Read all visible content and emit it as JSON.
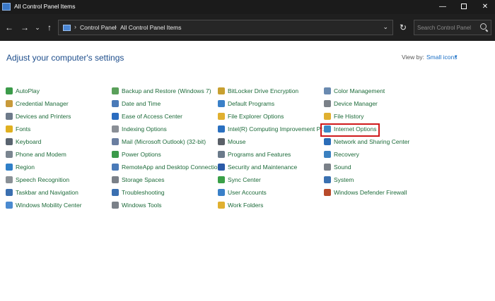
{
  "window": {
    "title": "All Control Panel Items",
    "controls": {
      "minimize": "—",
      "close": "✕"
    }
  },
  "navigation": {
    "back": "←",
    "forward": "→",
    "recent": "⌄",
    "up": "↑",
    "breadcrumb": [
      "Control Panel",
      "All Control Panel Items"
    ],
    "separator": "›",
    "dropdown": "⌄",
    "refresh": "↻",
    "search_placeholder": "Search Control Panel"
  },
  "header": {
    "title": "Adjust your computer's settings",
    "view_by_label": "View by:",
    "view_by_value": "Small icons",
    "view_by_caret": "▾"
  },
  "items": [
    {
      "label": "AutoPlay",
      "icon": "autoplay-icon",
      "color": "#3b9b4a"
    },
    {
      "label": "Credential Manager",
      "icon": "credential-manager-icon",
      "color": "#c89a3a"
    },
    {
      "label": "Devices and Printers",
      "icon": "devices-printers-icon",
      "color": "#6d7a8a"
    },
    {
      "label": "Fonts",
      "icon": "fonts-icon",
      "color": "#e0b020"
    },
    {
      "label": "Keyboard",
      "icon": "keyboard-icon",
      "color": "#5a6470"
    },
    {
      "label": "Phone and Modem",
      "icon": "phone-modem-icon",
      "color": "#7a8590"
    },
    {
      "label": "Region",
      "icon": "region-icon",
      "color": "#2f7fc8"
    },
    {
      "label": "Speech Recognition",
      "icon": "speech-recognition-icon",
      "color": "#8a9096"
    },
    {
      "label": "Taskbar and Navigation",
      "icon": "taskbar-icon",
      "color": "#3a6fb0"
    },
    {
      "label": "Windows Mobility Center",
      "icon": "mobility-center-icon",
      "color": "#4a8ad0"
    },
    {
      "label": "Backup and Restore (Windows 7)",
      "icon": "backup-restore-icon",
      "color": "#5aa05a"
    },
    {
      "label": "Date and Time",
      "icon": "date-time-icon",
      "color": "#4a7ab8"
    },
    {
      "label": "Ease of Access Center",
      "icon": "ease-of-access-icon",
      "color": "#2a6cc0"
    },
    {
      "label": "Indexing Options",
      "icon": "indexing-options-icon",
      "color": "#8a8f96"
    },
    {
      "label": "Mail (Microsoft Outlook) (32-bit)",
      "icon": "mail-icon",
      "color": "#6a7ea0"
    },
    {
      "label": "Power Options",
      "icon": "power-options-icon",
      "color": "#3a9a4a"
    },
    {
      "label": "RemoteApp and Desktop Connections",
      "icon": "remoteapp-icon",
      "color": "#4a7ab8"
    },
    {
      "label": "Storage Spaces",
      "icon": "storage-spaces-icon",
      "color": "#7a8088"
    },
    {
      "label": "Troubleshooting",
      "icon": "troubleshooting-icon",
      "color": "#3a6fb0"
    },
    {
      "label": "Windows Tools",
      "icon": "windows-tools-icon",
      "color": "#7a8088"
    },
    {
      "label": "BitLocker Drive Encryption",
      "icon": "bitlocker-icon",
      "color": "#c8a030"
    },
    {
      "label": "Default Programs",
      "icon": "default-programs-icon",
      "color": "#3a80c8"
    },
    {
      "label": "File Explorer Options",
      "icon": "file-explorer-options-icon",
      "color": "#e0b030"
    },
    {
      "label": "Intel(R) Computing Improvement Pr...",
      "icon": "intel-icon",
      "color": "#2a70c0"
    },
    {
      "label": "Mouse",
      "icon": "mouse-icon",
      "color": "#5a6068"
    },
    {
      "label": "Programs and Features",
      "icon": "programs-features-icon",
      "color": "#6a7a8a"
    },
    {
      "label": "Security and Maintenance",
      "icon": "security-maintenance-icon",
      "color": "#2a5aa8"
    },
    {
      "label": "Sync Center",
      "icon": "sync-center-icon",
      "color": "#3aa048"
    },
    {
      "label": "User Accounts",
      "icon": "user-accounts-icon",
      "color": "#3a80c8"
    },
    {
      "label": "Work Folders",
      "icon": "work-folders-icon",
      "color": "#e0b030"
    },
    {
      "label": "Color Management",
      "icon": "color-management-icon",
      "color": "#6a8ab0"
    },
    {
      "label": "Device Manager",
      "icon": "device-manager-icon",
      "color": "#7a8088"
    },
    {
      "label": "File History",
      "icon": "file-history-icon",
      "color": "#e0b030"
    },
    {
      "label": "Internet Options",
      "icon": "internet-options-icon",
      "color": "#3a8ac8"
    },
    {
      "label": "Network and Sharing Center",
      "icon": "network-sharing-icon",
      "color": "#2a6cb8"
    },
    {
      "label": "Recovery",
      "icon": "recovery-icon",
      "color": "#3a80c0"
    },
    {
      "label": "Sound",
      "icon": "sound-icon",
      "color": "#7a8088"
    },
    {
      "label": "System",
      "icon": "system-icon",
      "color": "#3a70b0"
    },
    {
      "label": "Windows Defender Firewall",
      "icon": "firewall-icon",
      "color": "#b84a2a"
    }
  ]
}
